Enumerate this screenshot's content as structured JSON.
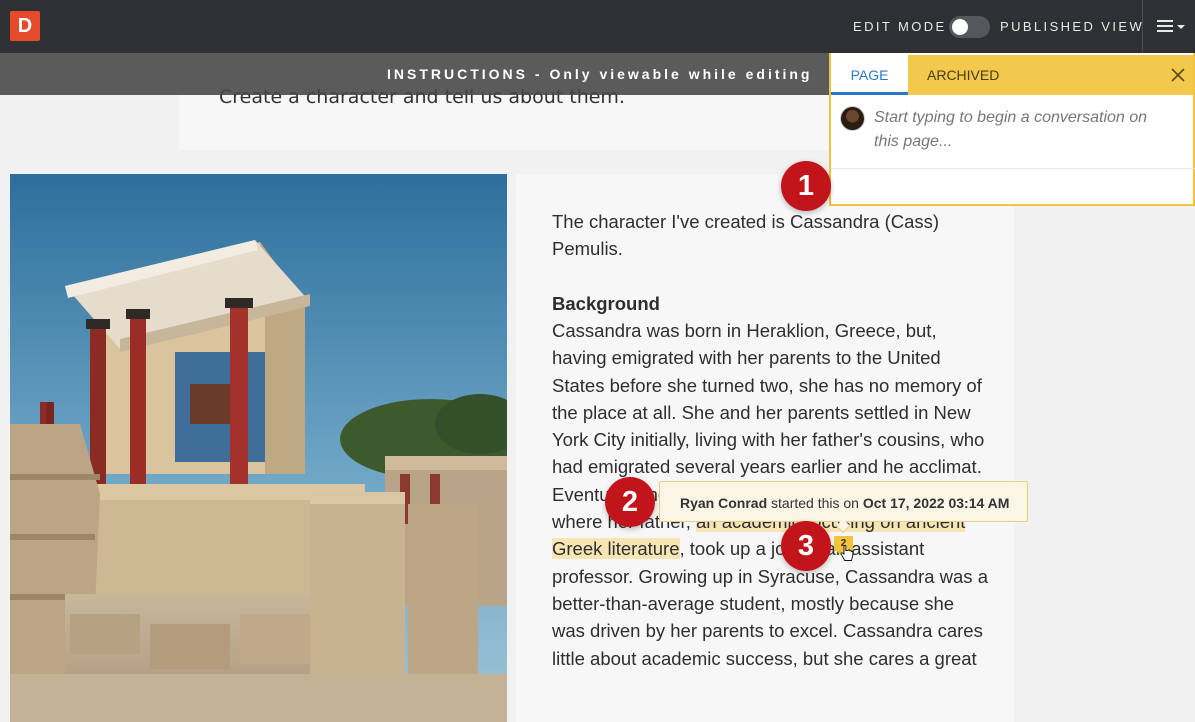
{
  "app": {
    "logo_letter": "D",
    "edit_mode_label": "EDIT MODE",
    "published_view_label": "PUBLISHED VIEW",
    "toggle_state": "off"
  },
  "instructions": {
    "banner": "INSTRUCTIONS - Only viewable while editing",
    "text": "Create a character and tell us about them."
  },
  "photo": {
    "subject": "ancient palace ruins with red columns"
  },
  "content": {
    "intro": "The character I've created is Cassandra (Cass) Pemulis.",
    "heading": "Background",
    "body_before": "Cassandra was born in Heraklion, Greece, but, having emigrated with her parents to the United States before she turned two, she has no memory of the place at all. She and her parents settled in New York City initially, living with her father's cousins, who had emigrated several years earlier and he",
    "body_acclimat": "acclimat",
    "body_eventually": ". Eventually the fa",
    "body_moved": "moved to Syracuse, New York, where ",
    "body_her": "her father, ",
    "body_highlight": "an academic focusing on ancient Greek literature",
    "body_after": ", took up a job as an assistant professor. Growing up in Syracuse, Cassandra was a better-than-average student, mostly because she was driven by her parents to excel. Cassandra cares little about academic success, but she cares a great"
  },
  "markers": {
    "page_marker_1": "1",
    "page_marker_2": "1",
    "inline_marker": "2"
  },
  "tooltip": {
    "author": "Ryan Conrad",
    "middle": " started this on ",
    "date": "Oct 17, 2022 03:14 AM"
  },
  "panel": {
    "tab_page": "PAGE",
    "tab_archived": "ARCHIVED",
    "close_icon": "close-icon",
    "placeholder": "Start typing to begin a conversation on this page..."
  },
  "callouts": [
    "1",
    "2",
    "3"
  ],
  "colors": {
    "topbar": "#2e3033",
    "accent_yellow": "#f2c43c",
    "tab_blue": "#2a78c7",
    "callout_red": "#c2141b",
    "highlight": "#f7e5b3",
    "logo": "#e54b2a"
  }
}
